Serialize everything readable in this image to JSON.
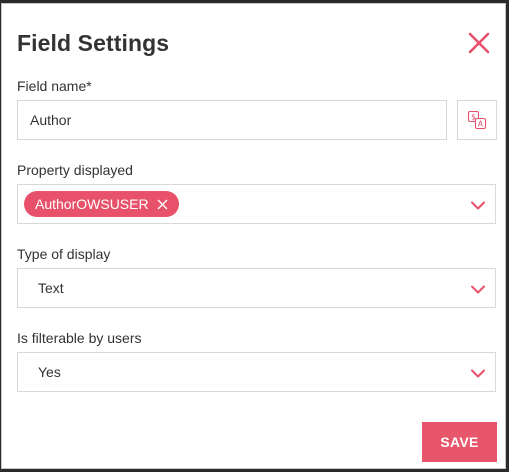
{
  "dialog": {
    "title": "Field Settings"
  },
  "fields": {
    "field_name": {
      "label": "Field name*",
      "value": "Author"
    },
    "property_displayed": {
      "label": "Property displayed",
      "tags": [
        "AuthorOWSUSER"
      ]
    },
    "type_of_display": {
      "label": "Type of display",
      "value": "Text"
    },
    "is_filterable": {
      "label": "Is filterable by users",
      "value": "Yes"
    }
  },
  "actions": {
    "save_label": "SAVE"
  },
  "colors": {
    "accent": "#e8516a",
    "border": "#d9d9d9",
    "text": "#333333"
  },
  "icons": {
    "close": "close-icon",
    "translate": "translate-icon",
    "dropdown": "chevron-down-icon",
    "tag_remove": "tag-remove-icon"
  }
}
